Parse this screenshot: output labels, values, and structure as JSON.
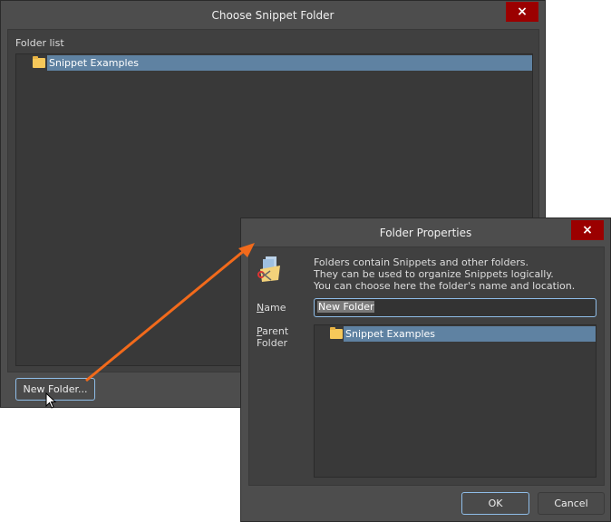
{
  "choose_dialog": {
    "title": "Choose Snippet Folder",
    "close": "×",
    "folder_list_label": "Folder list",
    "tree_items": [
      "Snippet Examples"
    ],
    "new_folder_button": "New Folder..."
  },
  "properties_dialog": {
    "title": "Folder Properties",
    "close": "×",
    "description": [
      "Folders contain Snippets and other folders.",
      "They can be used to organize Snippets logically.",
      "You can choose here the folder's name and location."
    ],
    "name_label_u": "N",
    "name_label_rest": "ame",
    "name_value": "New Folder",
    "parent_label_u": "P",
    "parent_label_rest": "arent",
    "parent_label_2": "Folder",
    "tree_items": [
      "Snippet Examples"
    ],
    "ok": "OK",
    "cancel": "Cancel"
  },
  "colors": {
    "arrow": "#f26a1b",
    "selection": "#5f82a2",
    "close": "#9b0000"
  }
}
